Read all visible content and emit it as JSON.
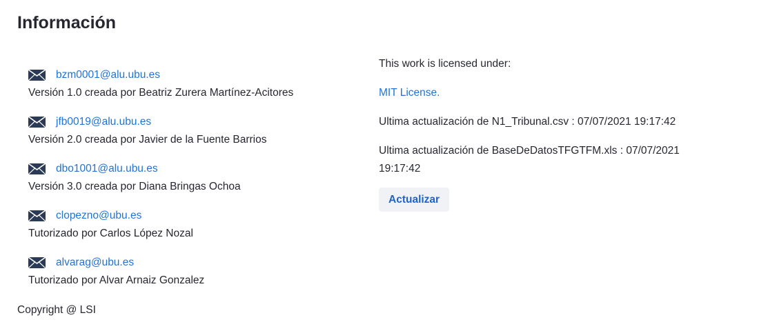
{
  "page": {
    "title": "Información"
  },
  "authors": [
    {
      "email": "bzm0001@alu.ubu.es",
      "description": "Versión 1.0 creada por Beatriz Zurera Martínez-Acitores"
    },
    {
      "email": "jfb0019@alu.ubu.es",
      "description": "Versión 2.0 creada por Javier de la Fuente Barrios"
    },
    {
      "email": "dbo1001@alu.ubu.es",
      "description": "Versión 3.0 creada por Diana Bringas Ochoa"
    },
    {
      "email": "clopezno@ubu.es",
      "description": "Tutorizado por Carlos López Nozal"
    },
    {
      "email": "alvarag@ubu.es",
      "description": "Tutorizado por Alvar Arnaiz Gonzalez"
    }
  ],
  "footer": {
    "copyright": "Copyright @ LSI"
  },
  "license": {
    "intro": "This work is licensed under:",
    "link_label": "MIT License."
  },
  "updates": {
    "tribunal": "Ultima actualización de N1_Tribunal.csv : 07/07/2021 19:17:42",
    "database": "Ultima actualización de BaseDeDatosTFGTFM.xls : 07/07/2021 19:17:42",
    "button_label": "Actualizar"
  },
  "colors": {
    "link": "#1f73d8",
    "text": "#262730",
    "button_bg": "#f0f2f6",
    "icon": "#2b3a55"
  },
  "icons": {
    "email": "envelope-icon"
  }
}
